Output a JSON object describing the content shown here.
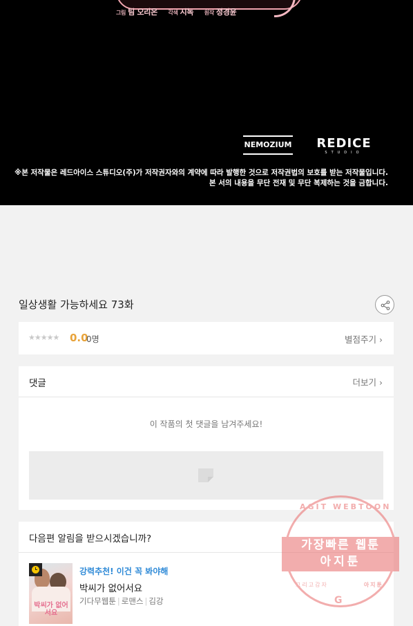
{
  "comic": {
    "credits": {
      "art_role": "그림",
      "art_name": "팀 오리온",
      "adapt_role": "각색",
      "adapt_name": "시녹",
      "orig_role": "원작",
      "orig_name": "정경윤"
    },
    "logo_left": "NEMOZIUM",
    "logo_right": "REDICE",
    "logo_right_sub": "STUDIO",
    "copyright_line1": "※본 저작물은 레드아이스 스튜디오(주)가 저작권자와의 계약에 따라 발행한 것으로 저작권법의 보호를 받는 저작물입니다.",
    "copyright_line2": "본 서의 내용을 무단 전재 및 무단 복제하는 것을 금합니다."
  },
  "episode": {
    "title": "일상생활 가능하세요 73화"
  },
  "rating": {
    "stars": "★★★★★",
    "score": "0.0",
    "count": "0명",
    "rate_link": "별점주기 ›"
  },
  "comments": {
    "title": "댓글",
    "more_link": "더보기 ›",
    "empty_message": "이 작품의 첫 댓글을 남겨주세요!"
  },
  "notify": {
    "question": "다음편 알림을 받으시겠습니까?"
  },
  "recommendation": {
    "tag": "강력추천! 이건 꼭 봐야해",
    "title": "박씨가 없어서요",
    "meta": [
      "기다무웹툰",
      "로맨스",
      "김강"
    ],
    "thumb_title": "박씨가 없어서요"
  },
  "watermark": {
    "top": "AGIT WEBTOON",
    "line1": "가장빠른 웹툰",
    "line2": "아지툰",
    "bottom_left": "그리고감자",
    "bottom_right": "아지툰",
    "mark": "G"
  },
  "colors": {
    "score": "#e8a33a",
    "tag": "#2f8ad7",
    "stamp": "#e96b6b"
  }
}
